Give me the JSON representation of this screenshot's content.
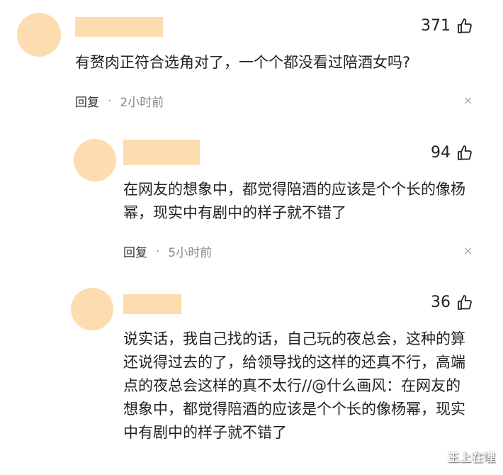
{
  "colors": {
    "placeholder": "#fddcaf",
    "text": "#222222",
    "meta": "#888888"
  },
  "comments": [
    {
      "likes": "371",
      "text": "有赘肉正符合选角对了，一个个都没看过陪酒女吗?",
      "reply_label": "回复",
      "separator": "·",
      "time": "2小时前",
      "close_glyph": "×",
      "like_icon": "thumbs-up-icon"
    },
    {
      "likes": "94",
      "text": "在网友的想象中，都觉得陪酒的应该是个个长的像杨幂，现实中有剧中的样子就不错了",
      "reply_label": "回复",
      "separator": "·",
      "time": "5小时前",
      "close_glyph": "×",
      "like_icon": "thumbs-up-icon"
    },
    {
      "likes": "36",
      "text": "说实话，我自己找的话，自己玩的夜总会，这种的算还说得过去的了，给领导找的这样的还真不行，高端点的夜总会这样的真不太行//@什么画风：在网友的想象中，都觉得陪酒的应该是个个长的像杨幂，现实中有剧中的样子就不错了",
      "like_icon": "thumbs-up-icon"
    }
  ],
  "watermark": "王上在哩"
}
